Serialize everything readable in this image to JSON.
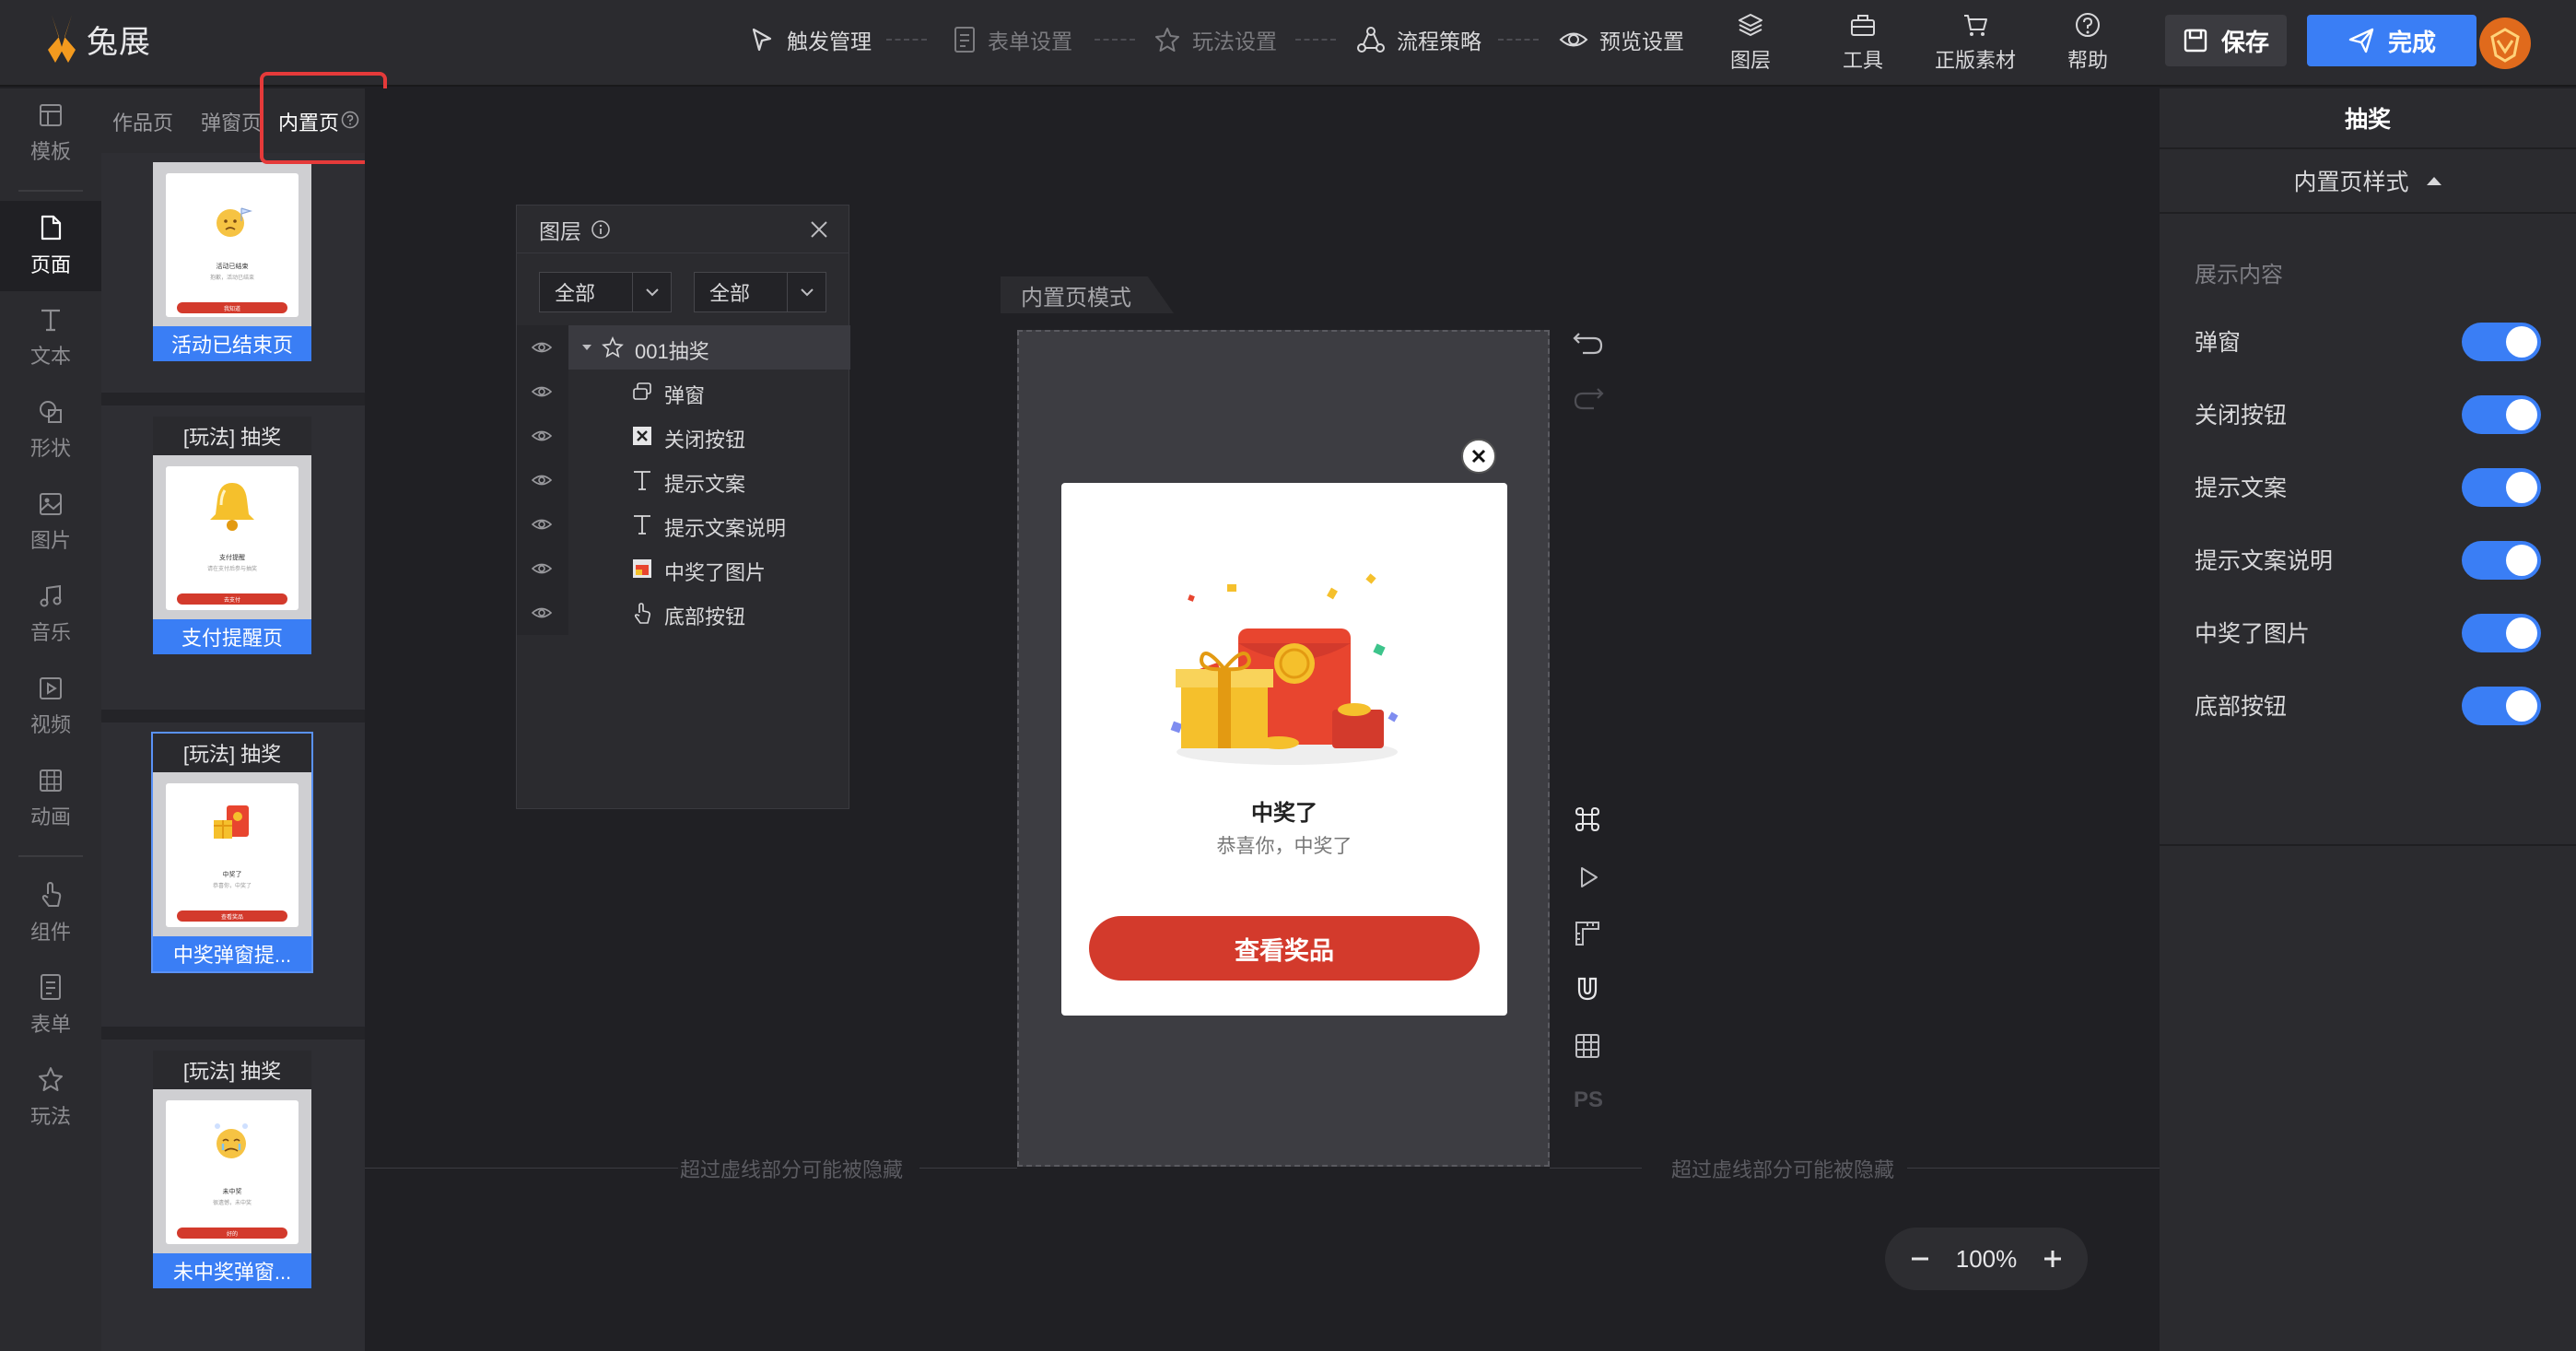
{
  "app": {
    "name": "兔展"
  },
  "steps": [
    {
      "label": "触发管理",
      "icon": "trigger-icon",
      "active": true
    },
    {
      "label": "表单设置",
      "icon": "form-icon",
      "active": false
    },
    {
      "label": "玩法设置",
      "icon": "star-icon",
      "active": false
    },
    {
      "label": "流程策略",
      "icon": "flow-icon",
      "active": true
    },
    {
      "label": "预览设置",
      "icon": "eye-icon",
      "active": true
    }
  ],
  "tools": [
    {
      "label": "图层",
      "icon": "layers-icon"
    },
    {
      "label": "工具",
      "icon": "toolbox-icon"
    },
    {
      "label": "正版素材",
      "icon": "cart-icon"
    },
    {
      "label": "帮助",
      "icon": "help-icon"
    }
  ],
  "actions": {
    "save": "保存",
    "done": "完成"
  },
  "leftnav": [
    {
      "label": "模板",
      "icon": "template-icon"
    },
    {
      "label": "页面",
      "icon": "page-icon",
      "active": true
    },
    {
      "label": "文本",
      "icon": "text-icon"
    },
    {
      "label": "形状",
      "icon": "shape-icon"
    },
    {
      "label": "图片",
      "icon": "image-icon"
    },
    {
      "label": "音乐",
      "icon": "music-icon"
    },
    {
      "label": "视频",
      "icon": "video-icon"
    },
    {
      "label": "动画",
      "icon": "animation-icon"
    },
    {
      "label": "组件",
      "icon": "component-icon"
    },
    {
      "label": "表单",
      "icon": "form-icon"
    },
    {
      "label": "玩法",
      "icon": "play-icon"
    }
  ],
  "pagetabs": {
    "works": "作品页",
    "popup": "弹窗页",
    "builtin": "内置页"
  },
  "thumbnails": [
    {
      "head": "",
      "foot": "活动已结束页",
      "card_title": "活动已结束",
      "card_sub": "抱歉，活动已结束",
      "card_btn": "我知道"
    },
    {
      "head": "[玩法] 抽奖",
      "foot": "支付提醒页",
      "card_title": "支付提醒",
      "card_sub": "请在支付后参与抽奖",
      "card_btn": "去支付"
    },
    {
      "head": "[玩法] 抽奖",
      "foot": "中奖弹窗提...",
      "card_title": "中奖了",
      "card_sub": "恭喜你，中奖了",
      "card_btn": "查看奖品"
    },
    {
      "head": "[玩法] 抽奖",
      "foot": "未中奖弹窗...",
      "card_title": "未中奖",
      "card_sub": "很遗憾，未中奖",
      "card_btn": "好的"
    }
  ],
  "layers": {
    "title": "图层",
    "filter1": "全部",
    "filter2": "全部",
    "items": [
      {
        "label": "001抽奖",
        "icon": "star-icon"
      },
      {
        "label": "弹窗",
        "icon": "popup-icon"
      },
      {
        "label": "关闭按钮",
        "icon": "close-image-icon"
      },
      {
        "label": "提示文案",
        "icon": "text-icon"
      },
      {
        "label": "提示文案说明",
        "icon": "text-icon"
      },
      {
        "label": "中奖了图片",
        "icon": "image-icon"
      },
      {
        "label": "底部按钮",
        "icon": "hand-icon"
      }
    ]
  },
  "canvas": {
    "mode_label": "内置页模式",
    "hint_left": "超过虚线部分可能被隐藏",
    "hint_right": "超过虚线部分可能被隐藏",
    "zoom": "100%"
  },
  "popup": {
    "title": "中奖了",
    "subtitle": "恭喜你，中奖了",
    "button": "查看奖品"
  },
  "rightpanel": {
    "title": "抽奖",
    "subtitle": "内置页样式",
    "section": "展示内容",
    "toggles": [
      {
        "label": "弹窗",
        "on": true
      },
      {
        "label": "关闭按钮",
        "on": true
      },
      {
        "label": "提示文案",
        "on": true
      },
      {
        "label": "提示文案说明",
        "on": true
      },
      {
        "label": "中奖了图片",
        "on": true
      },
      {
        "label": "底部按钮",
        "on": true
      }
    ]
  },
  "colors": {
    "accent": "#3a7ef5",
    "danger": "#d33a2c",
    "highlight": "#e53a3a"
  }
}
